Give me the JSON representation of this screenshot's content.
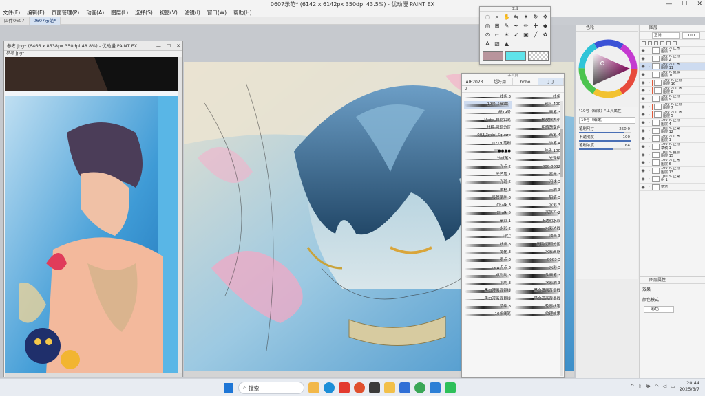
{
  "window": {
    "title": "0607示范* (6142 x 6142px 350dpi 43.5%) - 优动漫 PAINT EX",
    "controls": [
      "—",
      "☐",
      "✕"
    ]
  },
  "menu": [
    "文件(F)",
    "编辑(E)",
    "页面管理(P)",
    "动画(A)",
    "图层(L)",
    "选择(S)",
    "视图(V)",
    "滤镜(I)",
    "窗口(W)",
    "帮助(H)"
  ],
  "doc_tabs": [
    {
      "label": "四件0607",
      "active": false
    },
    {
      "label": "0607示范*",
      "active": true
    }
  ],
  "reference": {
    "title": "参考.jpg* (6466 x 8538px 350dpi 48.8%) - 优动漫 PAINT EX",
    "tab": "参考.jpg*",
    "controls": [
      "—",
      "☐",
      "✕"
    ]
  },
  "tool_palette": {
    "title": "工具",
    "tools": [
      "◌",
      "⌕",
      "✋",
      "⇆",
      "✦",
      "↻",
      "✥",
      "◎",
      "⊞",
      "✎",
      "✒",
      "✏",
      "✚",
      "◆",
      "⊘",
      "⌐",
      "✶",
      "➹",
      "▣",
      "╱",
      "✿",
      "A",
      "▧",
      "▲"
    ],
    "main_color": "#b8949c",
    "sub_color": "#5fe3ea"
  },
  "subtool": {
    "title": "子工具",
    "tabs": [
      "AIE2023",
      "超好用",
      "hobo",
      "丁丁"
    ],
    "sub_label": "2",
    "brushes": [
      {
        "name": "线条 3",
        "sel": false
      },
      {
        "name": "线条",
        "sel": false
      },
      {
        "name": "19号（细致）",
        "sel": true
      },
      {
        "name": "颜料 400",
        "sel": false
      },
      {
        "name": "细19号",
        "sel": false
      },
      {
        "name": "画笔 3",
        "sel": false
      },
      {
        "name": "Moho 自创铅笔",
        "sel": false
      },
      {
        "name": "橡皮擦大小",
        "sel": false
      },
      {
        "name": "线稿-可调分区",
        "sel": false
      },
      {
        "name": "明暗渐变色",
        "sel": false
      },
      {
        "name": "003 3mini Square",
        "sel": false
      },
      {
        "name": "画笔 4",
        "sel": false
      },
      {
        "name": "0219 笔刷",
        "sel": false
      },
      {
        "name": "沙笔 4",
        "sel": false
      },
      {
        "name": "lll●●●●",
        "sel": false
      },
      {
        "name": "粒子 100",
        "sel": false
      },
      {
        "name": "沙点笔3",
        "sel": false
      },
      {
        "name": "光泽绘",
        "sel": false
      },
      {
        "name": "光点 2",
        "sel": false
      },
      {
        "name": "000 0032",
        "sel": false
      },
      {
        "name": "光芒笔 1",
        "sel": false
      },
      {
        "name": "星光 3",
        "sel": false
      },
      {
        "name": "光斑 2",
        "sel": false
      },
      {
        "name": "泡沫 3",
        "sel": false
      },
      {
        "name": "喷枪 3",
        "sel": false
      },
      {
        "name": "点刷 3",
        "sel": false
      },
      {
        "name": "吸管笔刷 3",
        "sel": false
      },
      {
        "name": "铅笔 3",
        "sel": false
      },
      {
        "name": "Chalk 3",
        "sel": false
      },
      {
        "name": "水彩 3",
        "sel": false
      },
      {
        "name": "Chalk 5",
        "sel": false
      },
      {
        "name": "画笔刀-2",
        "sel": false
      },
      {
        "name": "晕染 1",
        "sel": false
      },
      {
        "name": "不透明水彩",
        "sel": false
      },
      {
        "name": "水彩 2",
        "sel": false
      },
      {
        "name": "水彩边线",
        "sel": false
      },
      {
        "name": "浮尘",
        "sel": false
      },
      {
        "name": "油画 3",
        "sel": false
      },
      {
        "name": "线条 3",
        "sel": false
      },
      {
        "name": "线稿-可调分区",
        "sel": false
      },
      {
        "name": "雾化 3",
        "sel": false
      },
      {
        "name": "水彩画感",
        "sel": false
      },
      {
        "name": "墨点 3",
        "sel": false
      },
      {
        "name": "0003 3",
        "sel": false
      },
      {
        "name": "new点点 3",
        "sel": false
      },
      {
        "name": "水彩 3",
        "sel": false
      },
      {
        "name": "点彩刷 3",
        "sel": false
      },
      {
        "name": "油画笔 3",
        "sel": false
      },
      {
        "name": "平刷 3",
        "sel": false
      },
      {
        "name": "水彩刷 3",
        "sel": false
      },
      {
        "name": "黑白漫画背景线",
        "sel": false
      },
      {
        "name": "黑白漫画背景线",
        "sel": false
      },
      {
        "name": "黑白漫画背景线",
        "sel": false
      },
      {
        "name": "黑白漫画背景线",
        "sel": false
      },
      {
        "name": "草绘 3",
        "sel": false
      },
      {
        "name": "轮廓线笔",
        "sel": false
      },
      {
        "name": "10条线笔",
        "sel": false
      },
      {
        "name": "纹理效果",
        "sel": false
      }
    ]
  },
  "color_panel": {
    "tab": "色轮",
    "hue_color": "#c4118a"
  },
  "brush_props": {
    "brush_title": "19号（细致）",
    "brush_subtitle": "\"19号（细致）\"工具属性",
    "size_label": "笔刷尺寸",
    "size_value": "250.0",
    "size_fill": 0.85,
    "opacity_label": "不透明度",
    "opacity_value": "100",
    "opacity_fill": 1.0,
    "density_label": "笔刷浓度",
    "density_value": "64",
    "density_fill": 0.64
  },
  "layer_panel": {
    "tab": "图层",
    "blend_mode": "正常",
    "opacity": "100",
    "layers": [
      {
        "text": "100 % 正常\n图层 3",
        "sel": false,
        "mark": false
      },
      {
        "text": "100 % 正常\n图层 2",
        "sel": false,
        "mark": false
      },
      {
        "text": "100 % 正常\n图层 11",
        "sel": true,
        "mark": false
      },
      {
        "text": "100 % 叠加\n图层 10",
        "sel": false,
        "mark": false
      },
      {
        "text": "100 % 正常\n图层 16",
        "sel": false,
        "mark": true
      },
      {
        "text": "100 % 正常\n图层 8",
        "sel": false,
        "mark": true
      },
      {
        "text": "100 % 正常\n图层 9",
        "sel": false,
        "mark": false
      },
      {
        "text": "100 % 正常\n图层 7",
        "sel": false,
        "mark": true
      },
      {
        "text": "100 % 正常\n图层 5",
        "sel": false,
        "mark": true
      },
      {
        "text": "100 % 正常\n图层 4",
        "sel": false,
        "mark": false
      },
      {
        "text": "100 % 正常\n图层 12",
        "sel": false,
        "mark": false
      },
      {
        "text": "100 % 正常\n图层 1",
        "sel": false,
        "mark": false
      },
      {
        "text": "100 % 正常\n草稿 1",
        "sel": false,
        "mark": false
      },
      {
        "text": "100 % 叠加\n图层 15",
        "sel": false,
        "mark": false
      },
      {
        "text": "100 % 正常\n图层 6",
        "sel": false,
        "mark": false
      },
      {
        "text": "100 % 正常\n图层 13",
        "sel": false,
        "mark": false
      },
      {
        "text": "100 % 正常\n组 1",
        "sel": false,
        "mark": false
      },
      {
        "text": "纸张",
        "sel": false,
        "mark": false
      }
    ]
  },
  "layer_props": {
    "tab": "图层属性",
    "effect_label": "效果",
    "color_mode_label": "颜色模式",
    "color_mode_value": "彩色"
  },
  "taskbar": {
    "search_placeholder": "搜索",
    "ime": "英",
    "time": "20:44",
    "date": "2025/6/7"
  }
}
